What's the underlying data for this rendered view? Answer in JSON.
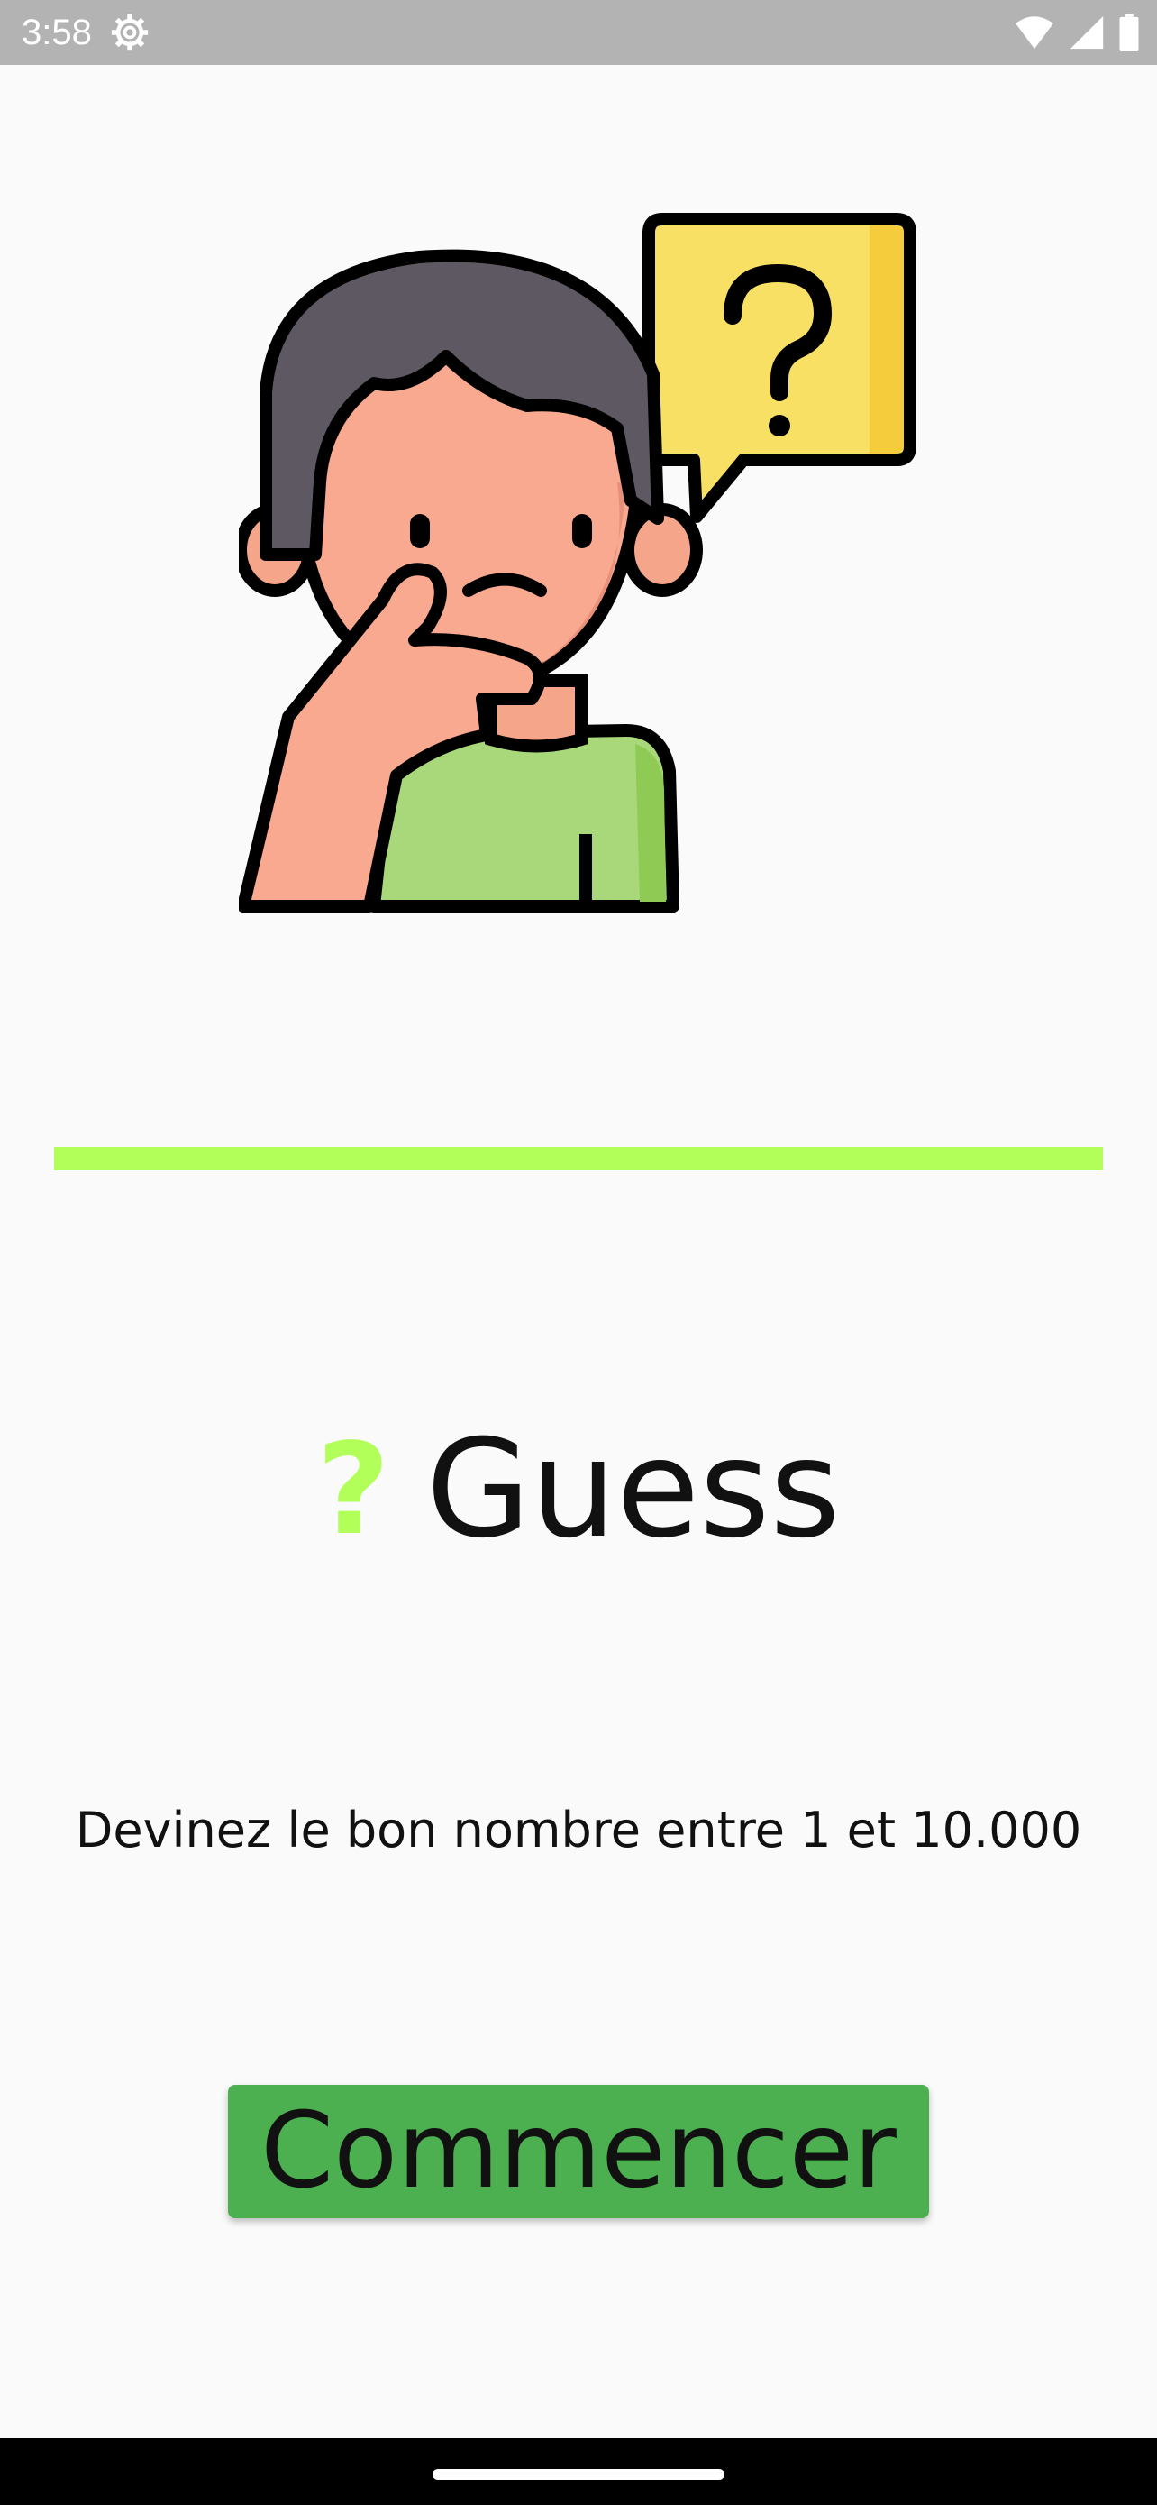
{
  "status_bar": {
    "time": "3:58",
    "icons": [
      "settings-icon",
      "wifi-icon",
      "signal-icon",
      "battery-icon"
    ]
  },
  "illustration": {
    "icon": "thinking-person-with-question-bubble"
  },
  "title": {
    "symbol": "?",
    "text": "Guess"
  },
  "subtitle": "Devinez le bon nombre entre 1 et 10.000",
  "start_button": {
    "label": "Commencer"
  },
  "colors": {
    "accent": "#b2ff59",
    "button": "#4caf50",
    "background": "#fafafa"
  }
}
